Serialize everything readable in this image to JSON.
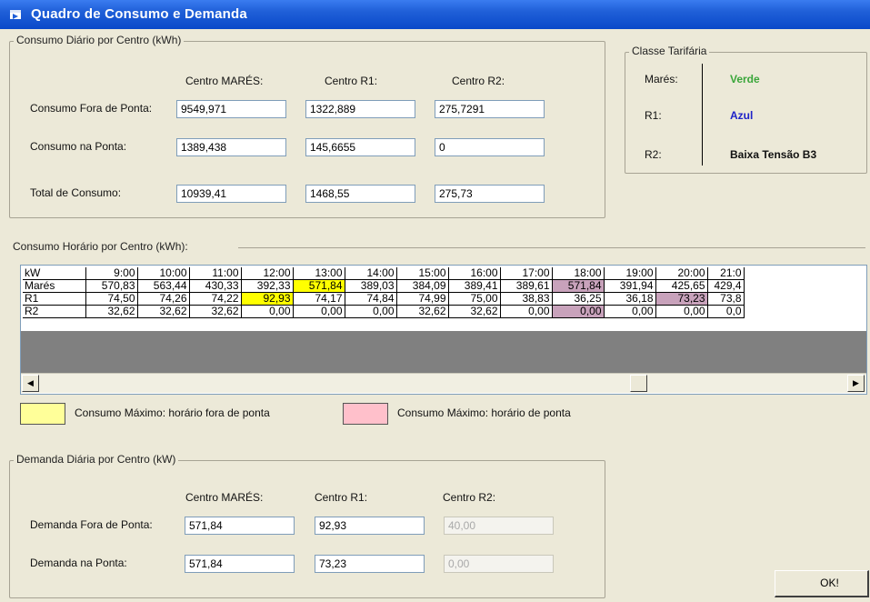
{
  "window": {
    "title": "Quadro de Consumo e Demanda"
  },
  "consumo_diario": {
    "legend": "Consumo Diário por Centro (kWh)",
    "col_headers": [
      "Centro MARÉS:",
      "Centro R1:",
      "Centro R2:"
    ],
    "rows": [
      {
        "label": "Consumo Fora de Ponta:",
        "values": [
          "9549,971",
          "1322,889",
          "275,7291"
        ]
      },
      {
        "label": "Consumo na Ponta:",
        "values": [
          "1389,438",
          "145,6655",
          "0"
        ]
      },
      {
        "label": "Total de Consumo:",
        "values": [
          "10939,41",
          "1468,55",
          "275,73"
        ]
      }
    ]
  },
  "classe_tarifaria": {
    "legend": "Classe Tarifária",
    "rows": [
      {
        "label": "Marés:",
        "value": "Verde",
        "color": "#3aa63a"
      },
      {
        "label": "R1:",
        "value": "Azul",
        "color": "#1e22c8"
      },
      {
        "label": "R2:",
        "value": "Baixa Tensão B3",
        "color": "#000000"
      }
    ]
  },
  "consumo_horario": {
    "legend": "Consumo Horário por Centro (kWh):",
    "corner": "kW",
    "hours": [
      "9:00",
      "10:00",
      "11:00",
      "12:00",
      "13:00",
      "14:00",
      "15:00",
      "16:00",
      "17:00",
      "18:00",
      "19:00",
      "20:00",
      "21:0"
    ],
    "rows": [
      {
        "label": "Marés",
        "values": [
          "570,83",
          "563,44",
          "430,33",
          "392,33",
          "571,84",
          "389,03",
          "384,09",
          "389,41",
          "389,61",
          "571,84",
          "391,94",
          "425,65",
          "429,4"
        ]
      },
      {
        "label": "R1",
        "values": [
          "74,50",
          "74,26",
          "74,22",
          "92,93",
          "74,17",
          "74,84",
          "74,99",
          "75,00",
          "38,83",
          "36,25",
          "36,18",
          "73,23",
          "73,8"
        ]
      },
      {
        "label": "R2",
        "values": [
          "32,62",
          "32,62",
          "32,62",
          "0,00",
          "0,00",
          "0,00",
          "32,62",
          "32,62",
          "0,00",
          "0,00",
          "0,00",
          "0,00",
          "0,0"
        ]
      }
    ],
    "highlights_off_peak": [
      [
        0,
        4
      ],
      [
        1,
        3
      ]
    ],
    "highlights_peak": [
      [
        0,
        9
      ],
      [
        1,
        11
      ],
      [
        2,
        9
      ]
    ],
    "colors": {
      "off_peak": "#ffff00",
      "peak": "#c8a2bb",
      "off_peak_swatch": "#ffff99",
      "peak_swatch": "#ffc0cb"
    }
  },
  "legend_keys": {
    "off_peak": "Consumo Máximo: horário fora de ponta",
    "peak": "Consumo Máximo: horário de ponta"
  },
  "demanda_diaria": {
    "legend": "Demanda Diária por Centro (kW)",
    "col_headers": [
      "Centro MARÉS:",
      "Centro R1:",
      "Centro R2:"
    ],
    "rows": [
      {
        "label": "Demanda Fora de Ponta:",
        "values": [
          "571,84",
          "92,93",
          "40,00"
        ]
      },
      {
        "label": "Demanda na Ponta:",
        "values": [
          "571,84",
          "73,23",
          "0,00"
        ]
      }
    ]
  },
  "buttons": {
    "ok": "OK!"
  }
}
